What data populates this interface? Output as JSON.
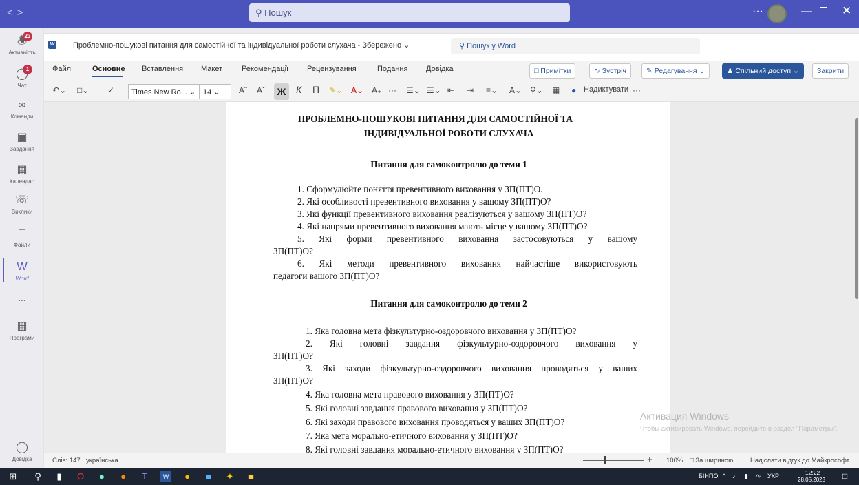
{
  "titlebar": {
    "back_icon": "chevron-left-icon",
    "forward_icon": "chevron-right-icon",
    "search_placeholder": "Пошук",
    "more_icon": "ellipsis-icon"
  },
  "rail": {
    "items": [
      {
        "label": "Активність",
        "icon": "bell-icon",
        "badge": "23"
      },
      {
        "label": "Чат",
        "icon": "chat-icon",
        "badge": "1"
      },
      {
        "label": "Команди",
        "icon": "teams-icon"
      },
      {
        "label": "Завдання",
        "icon": "tasks-icon"
      },
      {
        "label": "Календар",
        "icon": "calendar-icon"
      },
      {
        "label": "Виклики",
        "icon": "phone-icon"
      },
      {
        "label": "Файли",
        "icon": "file-icon"
      },
      {
        "label": "Word",
        "icon": "word-icon",
        "active": true
      },
      {
        "label": "Програми",
        "icon": "apps-icon"
      }
    ],
    "more": "...",
    "help_label": "Довідка"
  },
  "doc_header": {
    "title": "Проблемно-пошукові питання для самостійної та індивідуальної роботи слухача - Збережено",
    "search_label": "Пошук у Word"
  },
  "ribbon": {
    "tabs": [
      "Файл",
      "Основне",
      "Вставлення",
      "Макет",
      "Рекомендації",
      "Рецензування",
      "Подання",
      "Довідка"
    ],
    "active_tab": "Основне",
    "comments": "Примітки",
    "meet": "Зустріч",
    "editing": "Редагування",
    "share": "Спільний доступ",
    "close": "Закрити"
  },
  "toolbar": {
    "font_name": "Times New Ro...",
    "font_size": "14",
    "bold": "Ж",
    "italic": "К",
    "underline": "П",
    "dictate": "Надиктувати",
    "more": "···"
  },
  "document": {
    "title_line1": "ПРОБЛЕМНО-ПОШУКОВІ ПИТАННЯ ДЛЯ САМОСТІЙНОЇ ТА",
    "title_line2": "ІНДИВІДУАЛЬНОЇ РОБОТИ СЛУХАЧА",
    "section1": "Питання для самоконтролю до теми 1",
    "s1": [
      "1. Сформулюйте поняття превентивного виховання у ЗП(ПТ)О.",
      "2. Які особливості превентивного виховання у вашому ЗП(ПТ)О?",
      "3. Які функції превентивного виховання реалізуються у вашому ЗП(ПТ)О?",
      "4. Які напрями превентивного виховання мають місце у вашому ЗП(ПТ)О?",
      "5. Які форми превентивного виховання застосовуються у вашому",
      "ЗП(ПТ)О?",
      "6. Які методи превентивного виховання найчастіше використовують",
      "педагоги вашого ЗП(ПТ)О?"
    ],
    "section2": "Питання для самоконтролю до теми 2",
    "s2": [
      "1. Яка головна мета фізкультурно-оздоровчого виховання у ЗП(ПТ)О?",
      "2. Які головні завдання фізкультурно-оздоровчого виховання у",
      "ЗП(ПТ)О?",
      "3. Які заходи фізкультурно-оздоровчого виховання проводяться у ваших",
      "ЗП(ПТ)О?",
      "4. Яка головна мета правового виховання у ЗП(ПТ)О?",
      "5. Які головні завдання правового виховання у ЗП(ПТ)О?",
      "6. Які заходи правового виховання проводяться у ваших ЗП(ПТ)О?",
      "7. Яка мета морально-етичного виховання у ЗП(ПТ)О?",
      "8. Які головні завдання морально-етичного виховання у ЗП(ПТ)О?"
    ]
  },
  "watermark": {
    "line1": "Активация Windows",
    "line2": "Чтобы активировать Windows, перейдите в раздел \"Параметры\"."
  },
  "status": {
    "words": "Слів: 147",
    "language": "українська",
    "zoom": "100%",
    "fit": "За шириною",
    "feedback": "Надіслати відгук до Майкрософт"
  },
  "taskbar": {
    "lang_indicator": "БІНПО",
    "keyboard": "УКР",
    "time": "12:22",
    "date": "28.05.2023"
  }
}
